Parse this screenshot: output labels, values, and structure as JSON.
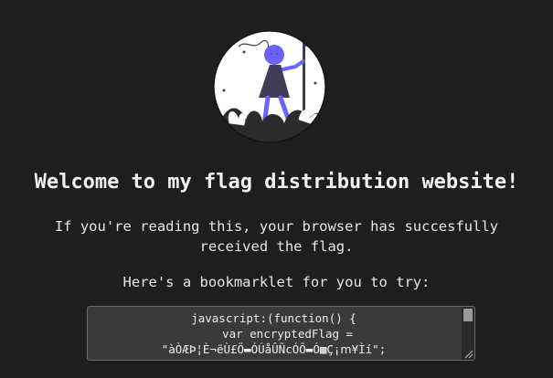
{
  "hero": {
    "illustration_icon": "person-holding-flag-illustration",
    "accent_color": "#6c63ff"
  },
  "content": {
    "title": "Welcome to my flag distribution website!",
    "intro_line1": "If you're reading this, your browser has succesfully",
    "intro_line2": "received the flag.",
    "bookmarklet_label": "Here's a bookmarklet for you to try:"
  },
  "bookmarklet": {
    "code_line1": "javascript:(function() {",
    "code_line2": "    var encryptedFlag =",
    "code_line3": "\"àÒÆÞ¦È¬ëÙ£Ö▬ÓÚåÛÑcÓÕ▬Ó▩Ç¡ⅿ¥Ìí\";"
  }
}
